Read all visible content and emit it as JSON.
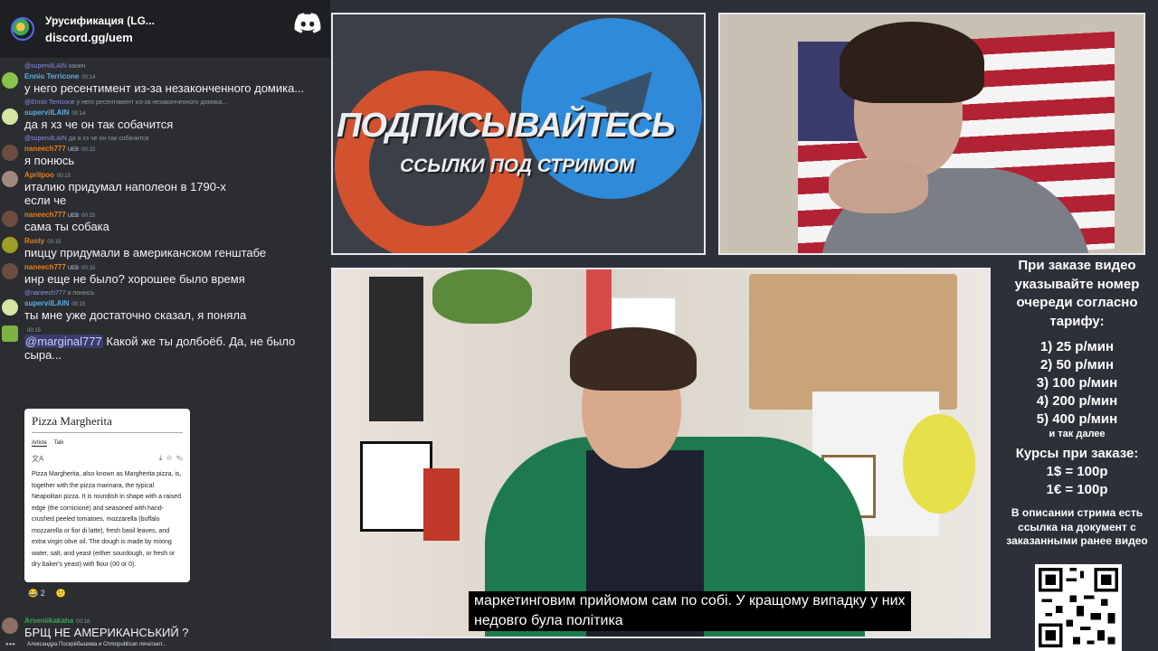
{
  "server": {
    "name": "Урусификация (LG...",
    "invite": "discord.gg/uem"
  },
  "messages": [
    {
      "reply": {
        "name": "@supervilLAIN",
        "text": "ханич"
      },
      "user": "Ennio Terricone",
      "user_color": "#5dade2",
      "badges": "",
      "time": "00:14",
      "text": "у него ресентимент из-за незаконченного домика..."
    },
    {
      "reply": {
        "name": "@Ennio Terricone",
        "text": "у него ресентимент из-за незаконченного домика..."
      },
      "user": "supervilLAIN",
      "user_color": "#5dade2",
      "badges": "",
      "time": "00:14",
      "text": "да я хз че он так собачится"
    },
    {
      "reply": {
        "name": "@supervilLAIN",
        "text": "да я хз че он так собачится"
      },
      "user": "naneech777",
      "user_color": "#e67e22",
      "badges": "UEB",
      "time": "00:15",
      "text": "я понюсь"
    },
    {
      "reply": null,
      "user": "Aprilpoo",
      "user_color": "#e67e22",
      "badges": "",
      "time": "00:15",
      "text": "италию придумал наполеон в 1790-х",
      "text2": "если че"
    },
    {
      "reply": null,
      "user": "naneech777",
      "user_color": "#e67e22",
      "badges": "UEB",
      "time": "00:15",
      "text": "сама ты собака"
    },
    {
      "reply": null,
      "user": "Rusty",
      "user_color": "#e67e22",
      "badges": "",
      "time": "00:15",
      "text": "пиццу придумали в американском генштабе"
    },
    {
      "reply": null,
      "user": "naneech777",
      "user_color": "#e67e22",
      "badges": "UEB",
      "time": "00:15",
      "text": "инр еще не было? хорошее было время"
    },
    {
      "reply": {
        "name": "@naneech777",
        "text": "я понюсь"
      },
      "user": "supervilLAIN",
      "user_color": "#5dade2",
      "badges": "",
      "time": "00:15",
      "text": "ты мне уже достаточно сказал, я поняла"
    },
    {
      "reply": null,
      "user": "",
      "user_color": "#e67e22",
      "badges": "",
      "time": "00:15",
      "mention": "@marginal777",
      "text": "Какой же ты долбоёб. Да, не было",
      "text2": "сыра..."
    }
  ],
  "wiki": {
    "title": "Pizza Margherita",
    "tab_article": "Article",
    "tab_talk": "Talk",
    "body": "Pizza Margherita, also known as Margherita pizza, is, together with the pizza marinara, the typical Neapolitan pizza. It is roundish in shape with a raised edge (the cornicione) and seasoned with hand-crushed peeled tomatoes, mozzarella (buffalo mozzarella or fior di latte), fresh basil leaves, and extra virgin olive oil. The dough is made by mixing water, salt, and yeast (either sourdough, or fresh or dry baker's yeast) with flour (00 or 0)."
  },
  "reactions": [
    {
      "emoji": "😂",
      "count": "2"
    },
    {
      "emoji": "🙂",
      "count": ""
    }
  ],
  "last_message": {
    "user": "Arseniikakaha",
    "time": "00:16",
    "text": "БРЩ НЕ АМЕРИКАНСЬКИЙ ?"
  },
  "typing": "Александра Поскрёбышева и Chmopublican печатают...",
  "promo": {
    "title": "ПОДПИСЫВАЙТЕСЬ",
    "subtitle": "ССЫЛКИ ПОД СТРИМОМ"
  },
  "video": {
    "caption_line1": "маркетинговим прийомом сам по собі. У кращому випадку у них",
    "caption_line2": "недовго була політика"
  },
  "info": {
    "header": "При заказе видео указывайте номер очереди согласно тарифу:",
    "tariffs": [
      "1) 25 р/мин",
      "2) 50 р/мин",
      "3) 100 р/мин",
      "4) 200 р/мин",
      "5) 400 р/мин"
    ],
    "tariffs_more": "и так далее",
    "rates_title": "Курсы при заказе:",
    "rates": [
      "1$ = 100р",
      "1€ = 100р"
    ],
    "note": "В описании стрима есть ссылка на документ с заказанными ранее видео"
  }
}
